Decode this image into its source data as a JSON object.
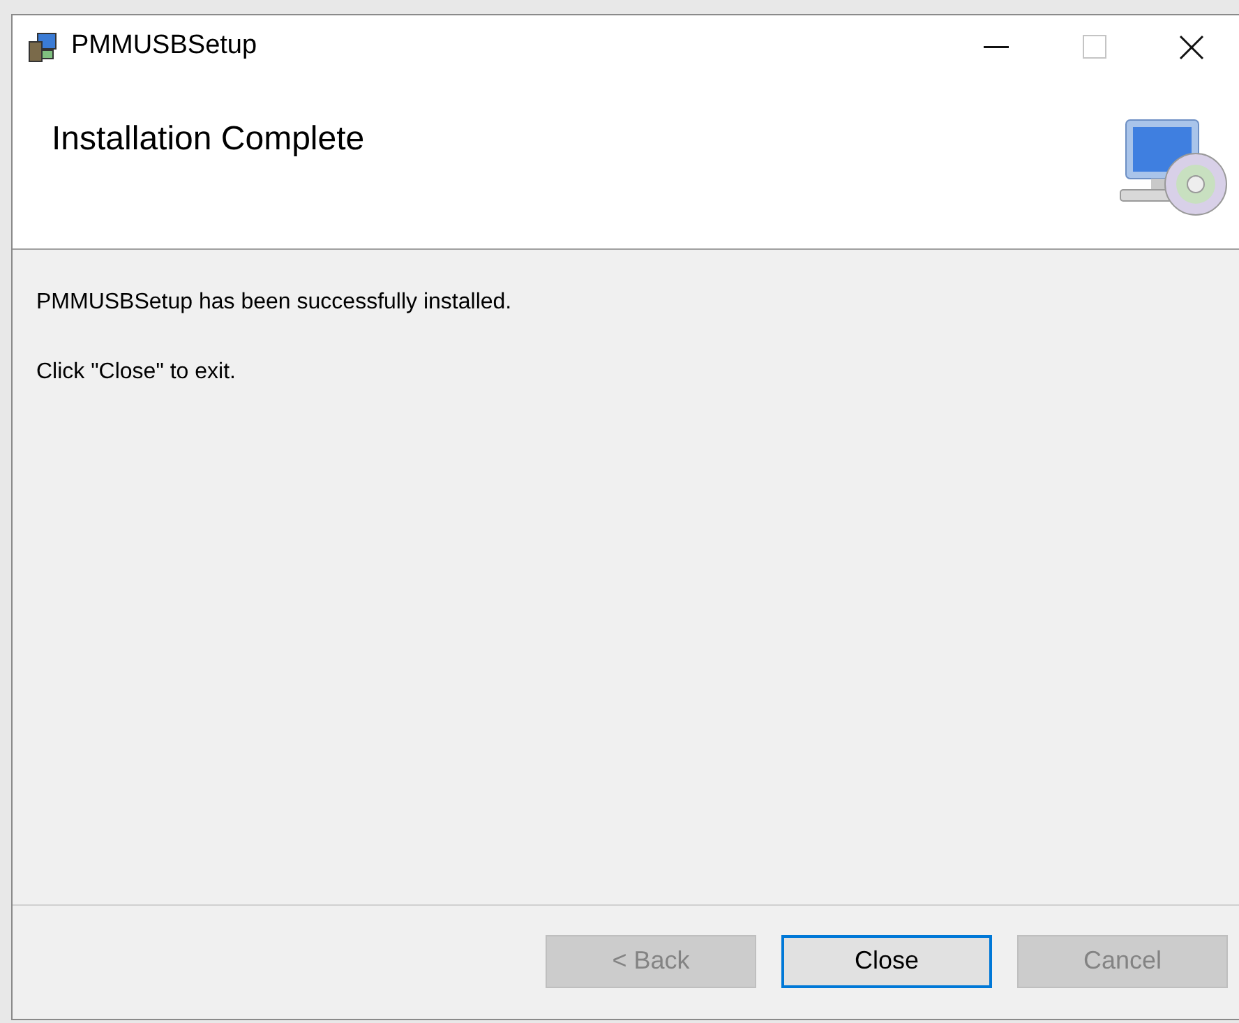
{
  "window": {
    "title": "PMMUSBSetup"
  },
  "header": {
    "title": "Installation Complete"
  },
  "body": {
    "paragraphs": [
      "PMMUSBSetup has been successfully installed.",
      "Click \"Close\" to exit."
    ]
  },
  "buttons": [
    {
      "label": "< Back",
      "disabled": true,
      "default": false
    },
    {
      "label": "Close",
      "disabled": false,
      "default": true
    },
    {
      "label": "Cancel",
      "disabled": true,
      "default": false
    }
  ]
}
